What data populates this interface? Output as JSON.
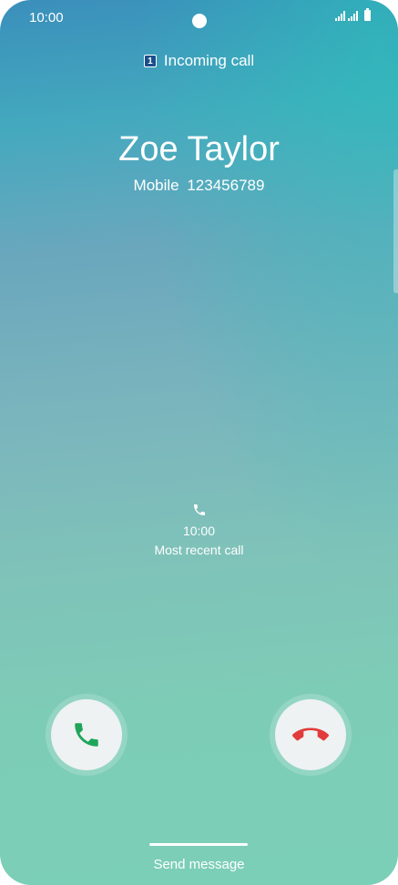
{
  "status_bar": {
    "time": "10:00"
  },
  "call": {
    "sim_slot": "1",
    "status_label": "Incoming call",
    "caller_name": "Zoe Taylor",
    "number_type": "Mobile",
    "number": "123456789",
    "number_line": "Mobile  123456789"
  },
  "recent_call": {
    "time": "10:00",
    "label": "Most recent call"
  },
  "actions": {
    "send_message": "Send message",
    "accept_icon": "phone-accept-icon",
    "reject_icon": "phone-reject-icon",
    "accept_color": "#1fa55a",
    "reject_color": "#e23b3b"
  }
}
